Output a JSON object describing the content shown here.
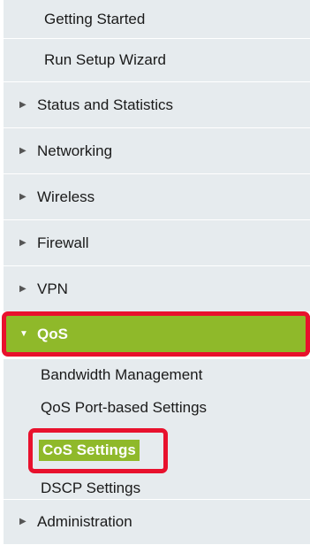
{
  "nav": {
    "getting_started": "Getting Started",
    "run_setup_wizard": "Run Setup Wizard",
    "status_and_statistics": "Status and Statistics",
    "networking": "Networking",
    "wireless": "Wireless",
    "firewall": "Firewall",
    "vpn": "VPN",
    "qos": "QoS",
    "administration": "Administration"
  },
  "qos_submenu": {
    "bandwidth_management": "Bandwidth Management",
    "qos_port_based_settings": "QoS Port-based Settings",
    "cos_settings": "CoS Settings",
    "dscp_settings": "DSCP Settings"
  },
  "icons": {
    "collapsed": "triangle-right-icon",
    "expanded": "triangle-down-icon"
  },
  "colors": {
    "menu_bg": "#e6ebee",
    "active_bg": "#8fb92a",
    "highlight_border": "#e8112d"
  }
}
